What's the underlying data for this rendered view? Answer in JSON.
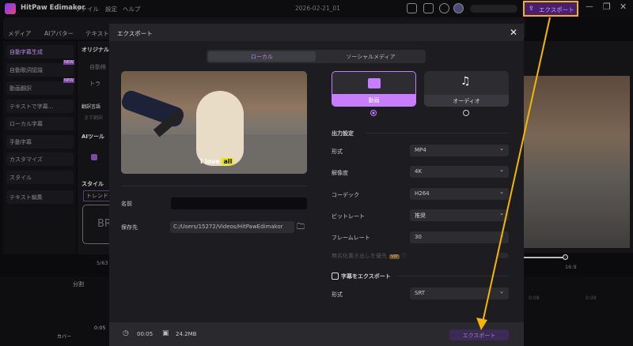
{
  "app": {
    "title": "HitPaw Edimakor",
    "menu": [
      "ファイル",
      "設定",
      "ヘルプ"
    ],
    "project_date": "2026-02-21_01",
    "export_label": "エクスポート"
  },
  "toolbar": {
    "tabs": [
      "メディア",
      "AIアバター",
      "テキスト"
    ]
  },
  "sidebar": {
    "items": [
      {
        "label": "自動字幕生成",
        "badge": ""
      },
      {
        "label": "自動歌詞認識",
        "badge": "NEW"
      },
      {
        "label": "動画翻訳",
        "badge": "NEW"
      },
      {
        "label": "テキストで字幕..."
      },
      {
        "label": "ローカル字幕"
      },
      {
        "label": "手動字幕"
      },
      {
        "label": "カスタマイズ"
      },
      {
        "label": "スタイル"
      },
      {
        "label": "テキスト編集"
      }
    ]
  },
  "middle": {
    "original": "オリジナル",
    "auto": "自動検",
    "track": "トラ",
    "translate_lang": "翻訳言語",
    "translate_ph": "まず翻訳",
    "ai_tools": "AIツール",
    "style": "スタイル",
    "trend": "トレンド",
    "preview_text": "BR",
    "credits": "5/63"
  },
  "timeline": {
    "split": "分割",
    "cover": "カバー",
    "clip_time": "0:05",
    "t1": "0:08",
    "t2": "0:09",
    "ratio": "16:9"
  },
  "dialog": {
    "title": "エクスポート",
    "tabs": [
      {
        "label": "ローカル",
        "active": true
      },
      {
        "label": "ソーシャルメディア",
        "active": false
      }
    ],
    "preview_caption": "I love",
    "preview_caption_highlight": "all",
    "name_label": "名前",
    "name_value": "",
    "save_label": "保存先",
    "save_path": "C:/Users/15272/Videos/HitPawEdimakor",
    "types": [
      {
        "label": "動画",
        "selected": true
      },
      {
        "label": "オーディオ",
        "selected": false
      }
    ],
    "output_settings": "出力設定",
    "settings": [
      {
        "label": "形式",
        "value": "MP4"
      },
      {
        "label": "解像度",
        "value": "4K"
      },
      {
        "label": "コーデック",
        "value": "H264"
      },
      {
        "label": "ビットレート",
        "value": "推奨"
      },
      {
        "label": "フレームレート",
        "value": "30"
      }
    ],
    "lossless_label": "無劣化書き出しを優先",
    "vip": "VIP",
    "subtitle_export": "字幕をエクスポート",
    "subtitle_format_label": "形式",
    "subtitle_format": "SRT",
    "duration": "00:05",
    "size": "24.2MB",
    "export_button": "エクスポート"
  },
  "colors": {
    "accent": "#c77dff",
    "highlight": "#f2b705"
  }
}
